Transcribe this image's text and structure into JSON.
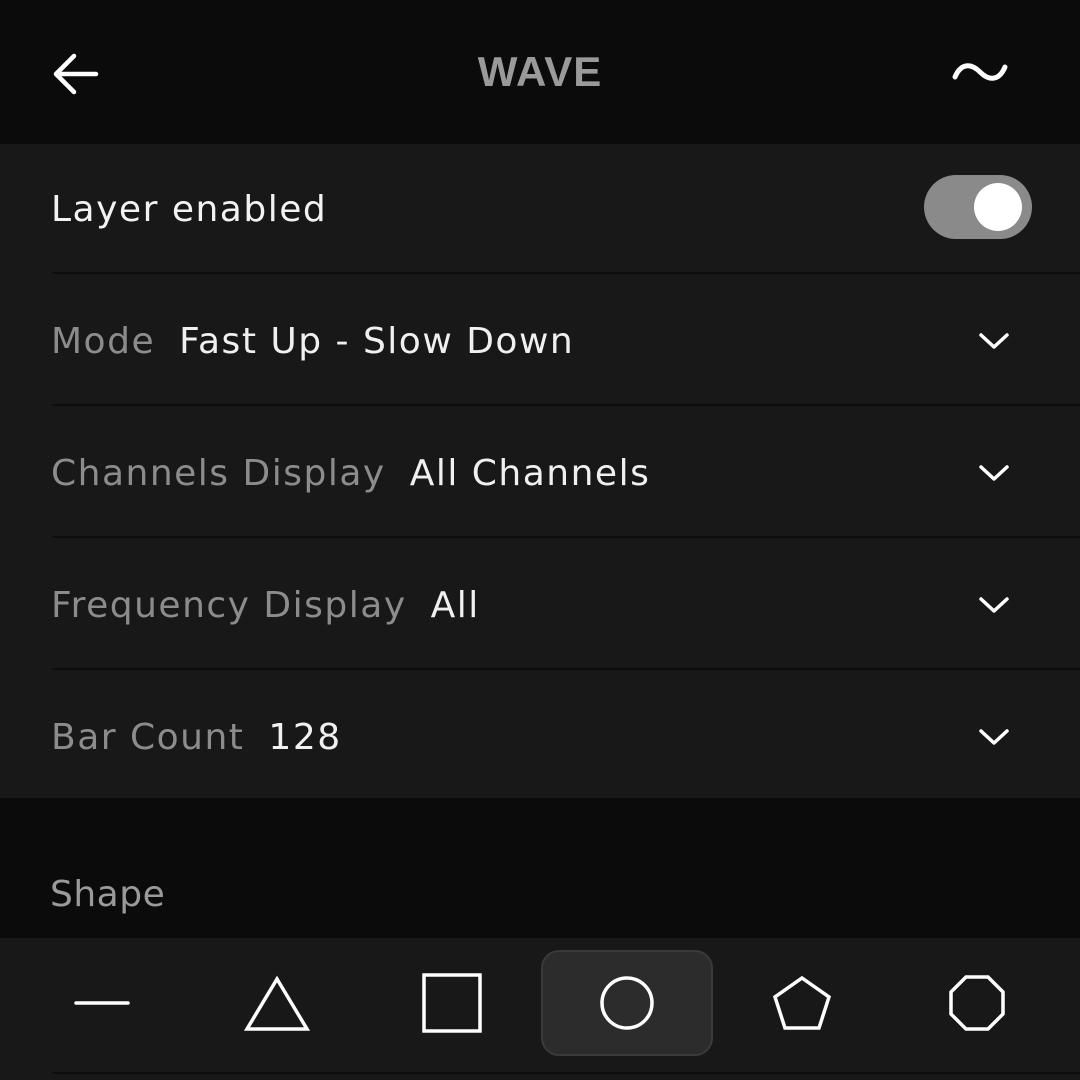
{
  "header": {
    "title": "WAVE",
    "back_icon": "arrow-left-icon",
    "right_icon": "tilde-wave-icon"
  },
  "settings": {
    "layer_enabled": {
      "label": "Layer enabled",
      "value": true
    },
    "rows": [
      {
        "key": "Mode",
        "value": "Fast Up - Slow Down"
      },
      {
        "key": "Channels Display",
        "value": "All Channels"
      },
      {
        "key": "Frequency Display",
        "value": "All"
      },
      {
        "key": "Bar Count",
        "value": "128"
      }
    ]
  },
  "shape": {
    "label": "Shape",
    "options": [
      "line",
      "triangle",
      "square",
      "circle",
      "pentagon",
      "octagon"
    ],
    "selected": "circle"
  },
  "colors": {
    "background": "#0b0b0b",
    "panel": "#181818",
    "toggle_track": "#8a8a8a",
    "text_primary": "#f0f0f0",
    "text_secondary": "#8c8c8c"
  }
}
